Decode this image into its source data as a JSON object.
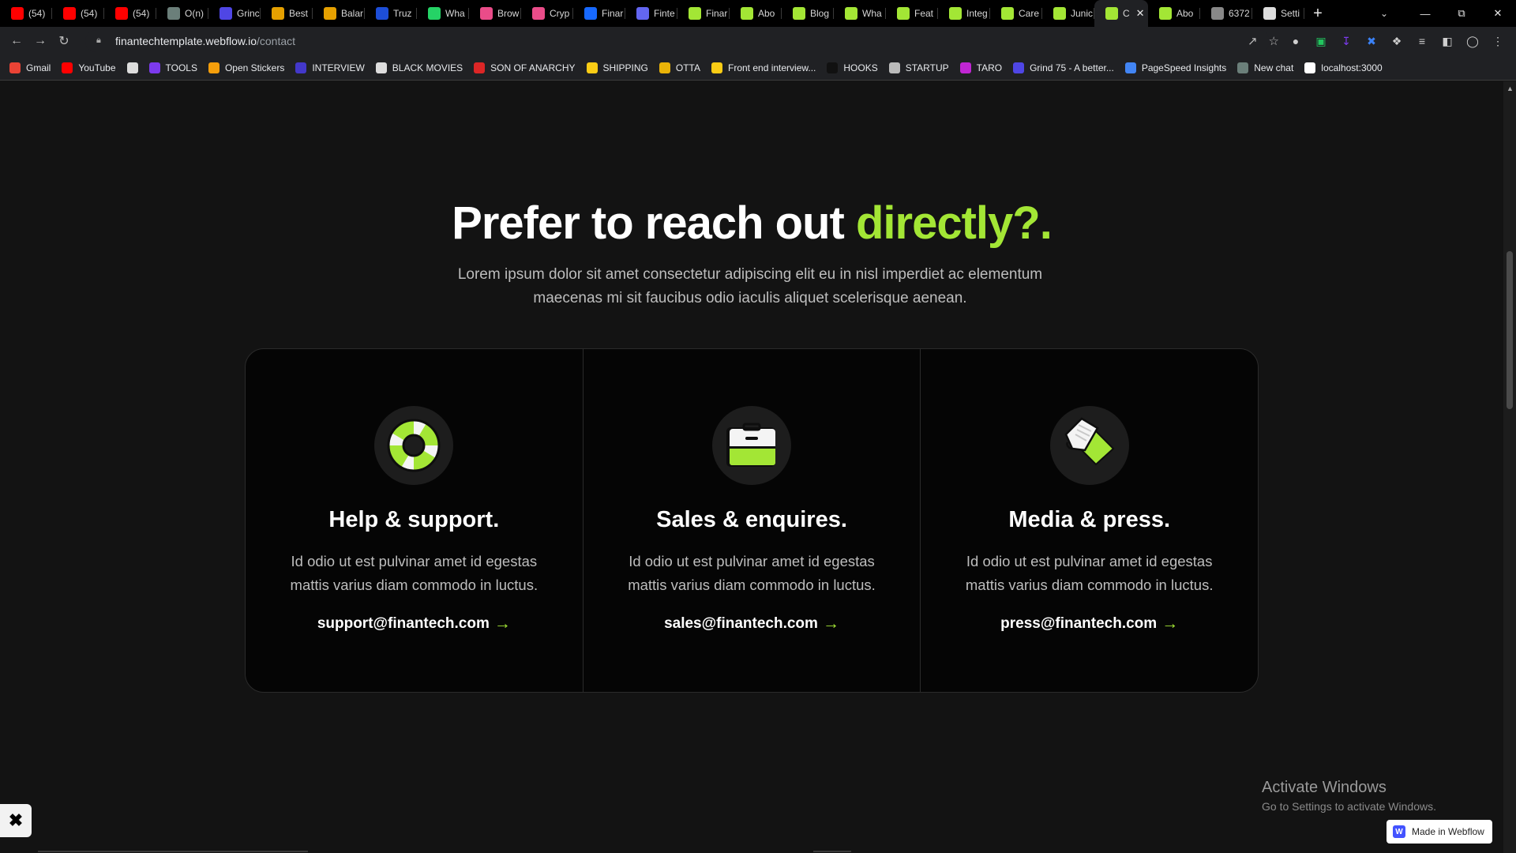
{
  "browser": {
    "tabs": [
      {
        "label": "(54)",
        "icon": "youtube-icon",
        "color": "#ff0000"
      },
      {
        "label": "(54)",
        "icon": "youtube-icon",
        "color": "#ff0000"
      },
      {
        "label": "(54)",
        "icon": "youtube-icon",
        "color": "#ff0000"
      },
      {
        "label": "O(n)",
        "icon": "chatgpt-icon",
        "color": "#6b7f7a"
      },
      {
        "label": "Grinc",
        "icon": "grind75-icon",
        "color": "#4f46e5"
      },
      {
        "label": "Best",
        "icon": "dot-icon",
        "color": "#e5a000"
      },
      {
        "label": "Balar",
        "icon": "dot-icon",
        "color": "#e5a000"
      },
      {
        "label": "Truz",
        "icon": "dot-icon",
        "color": "#1d4ed8"
      },
      {
        "label": "Wha",
        "icon": "whatsapp-icon",
        "color": "#25d366"
      },
      {
        "label": "Brow",
        "icon": "dribbble-icon",
        "color": "#ea4c89"
      },
      {
        "label": "Cryp",
        "icon": "dribbble-icon",
        "color": "#ea4c89"
      },
      {
        "label": "Finar",
        "icon": "behance-icon",
        "color": "#1769ff"
      },
      {
        "label": "Finte",
        "icon": "dots-icon",
        "color": "#6366f1"
      },
      {
        "label": "Finar",
        "icon": "finantech-icon",
        "color": "#a3e635"
      },
      {
        "label": "Abo",
        "icon": "finantech-icon",
        "color": "#a3e635"
      },
      {
        "label": "Blog",
        "icon": "finantech-icon",
        "color": "#a3e635"
      },
      {
        "label": "Wha",
        "icon": "finantech-icon",
        "color": "#a3e635"
      },
      {
        "label": "Feat",
        "icon": "finantech-icon",
        "color": "#a3e635"
      },
      {
        "label": "Integ",
        "icon": "finantech-icon",
        "color": "#a3e635"
      },
      {
        "label": "Care",
        "icon": "finantech-icon",
        "color": "#a3e635"
      },
      {
        "label": "Junic",
        "icon": "finantech-icon",
        "color": "#a3e635"
      },
      {
        "label": "C",
        "icon": "finantech-icon",
        "color": "#a3e635",
        "active": true
      },
      {
        "label": "Abo",
        "icon": "finantech-icon",
        "color": "#a3e635"
      },
      {
        "label": "6372",
        "icon": "globe-icon",
        "color": "#888888"
      },
      {
        "label": "Setti",
        "icon": "gear-icon",
        "color": "#dddddd"
      }
    ],
    "url_host": "finantechtemplate.webflow.io",
    "url_path": "/contact",
    "bookmarks": [
      {
        "label": "Gmail",
        "icon": "gmail-icon",
        "color": "#ea4335"
      },
      {
        "label": "YouTube",
        "icon": "youtube-icon",
        "color": "#ff0000"
      },
      {
        "label": "",
        "icon": "globe-icon",
        "color": "#dddddd"
      },
      {
        "label": "TOOLS",
        "icon": "tools-icon",
        "color": "#7c3aed"
      },
      {
        "label": "Open Stickers",
        "icon": "stickers-icon",
        "color": "#f59e0b"
      },
      {
        "label": "INTERVIEW",
        "icon": "interview-icon",
        "color": "#4338ca"
      },
      {
        "label": "BLACK MOVIES",
        "icon": "globe-icon",
        "color": "#dddddd"
      },
      {
        "label": "SON OF ANARCHY",
        "icon": "flag-icon",
        "color": "#dc2626"
      },
      {
        "label": "SHIPPING",
        "icon": "chevrons-icon",
        "color": "#facc15"
      },
      {
        "label": "OTTA",
        "icon": "otta-icon",
        "color": "#eab308"
      },
      {
        "label": "Front end interview...",
        "icon": "bookmark-icon",
        "color": "#facc15"
      },
      {
        "label": "HOOKS",
        "icon": "hooks-icon",
        "color": "#111111"
      },
      {
        "label": "STARTUP",
        "icon": "list-icon",
        "color": "#bbbbbb"
      },
      {
        "label": "TARO",
        "icon": "taro-icon",
        "color": "#c026d3"
      },
      {
        "label": "Grind 75 - A better...",
        "icon": "grind75-icon",
        "color": "#4f46e5"
      },
      {
        "label": "PageSpeed Insights",
        "icon": "pagespeed-icon",
        "color": "#4285f4"
      },
      {
        "label": "New chat",
        "icon": "chatgpt-icon",
        "color": "#6b7f7a"
      },
      {
        "label": "localhost:3000",
        "icon": "triangle-icon",
        "color": "#ffffff"
      }
    ]
  },
  "hero": {
    "title_main": "Prefer to reach out ",
    "title_accent": "directly?.",
    "subtitle": "Lorem ipsum dolor sit amet consectetur adipiscing elit eu in nisl imperdiet ac elementum maecenas mi sit faucibus odio iaculis aliquet scelerisque aenean."
  },
  "cards": [
    {
      "title": "Help & support.",
      "text": "Id odio ut est pulvinar amet id egestas mattis varius diam commodo in luctus.",
      "email": "support@finantech.com",
      "arrow": "→",
      "icon": "lifebuoy-icon"
    },
    {
      "title": "Sales & enquires.",
      "text": "Id odio ut est pulvinar amet id egestas mattis varius diam commodo in luctus.",
      "email": "sales@finantech.com",
      "arrow": "→",
      "icon": "briefcase-icon"
    },
    {
      "title": "Media & press.",
      "text": "Id odio ut est pulvinar amet id egestas mattis varius diam commodo in luctus.",
      "email": "press@finantech.com",
      "arrow": "→",
      "icon": "newspaper-icon"
    }
  ],
  "overlay": {
    "activate_title": "Activate Windows",
    "activate_sub": "Go to Settings to activate Windows.",
    "webflow_badge": "Made in Webflow",
    "webflow_logo": "W"
  },
  "colors": {
    "accent": "#a3e635",
    "background": "#131313",
    "card_bg": "#050505"
  }
}
